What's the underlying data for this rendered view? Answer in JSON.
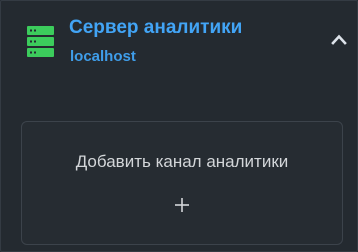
{
  "server": {
    "icon": "server-icon",
    "title": "Сервер аналитики",
    "host": "localhost",
    "expanded": true,
    "collapse_icon": "chevron-up-icon"
  },
  "add_channel": {
    "label": "Добавить канал аналитики",
    "icon": "plus-icon"
  },
  "colors": {
    "background": "#242a30",
    "server_icon": "#3ccc5c",
    "title_accent": "#42a4f5",
    "chevron": "#dde3ea",
    "card_border": "#3c434b",
    "label_text": "#d3d6d9"
  }
}
